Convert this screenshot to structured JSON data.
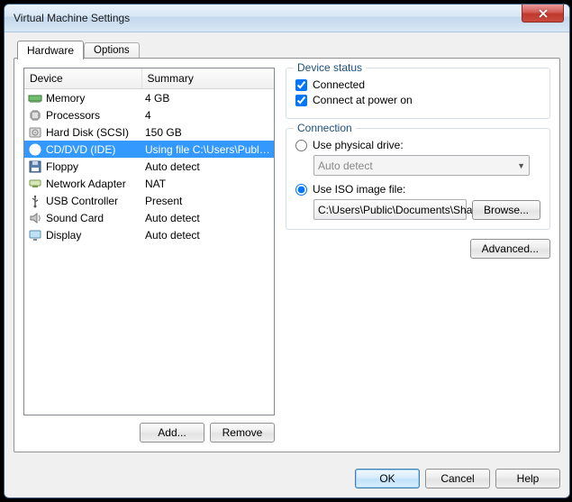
{
  "window": {
    "title": "Virtual Machine Settings"
  },
  "tabs": {
    "hardware": "Hardware",
    "options": "Options"
  },
  "headers": {
    "device": "Device",
    "summary": "Summary"
  },
  "devices": [
    {
      "icon": "memory",
      "name": "Memory",
      "summary": "4 GB"
    },
    {
      "icon": "cpu",
      "name": "Processors",
      "summary": "4"
    },
    {
      "icon": "hdd",
      "name": "Hard Disk (SCSI)",
      "summary": "150 GB"
    },
    {
      "icon": "cd",
      "name": "CD/DVD (IDE)",
      "summary": "Using file C:\\Users\\Public\\Doc..."
    },
    {
      "icon": "floppy",
      "name": "Floppy",
      "summary": "Auto detect"
    },
    {
      "icon": "net",
      "name": "Network Adapter",
      "summary": "NAT"
    },
    {
      "icon": "usb",
      "name": "USB Controller",
      "summary": "Present"
    },
    {
      "icon": "sound",
      "name": "Sound Card",
      "summary": "Auto detect"
    },
    {
      "icon": "display",
      "name": "Display",
      "summary": "Auto detect"
    }
  ],
  "left_buttons": {
    "add": "Add...",
    "remove": "Remove"
  },
  "groups": {
    "status": "Device status",
    "connection": "Connection"
  },
  "status": {
    "connected": "Connected",
    "connect_power_on": "Connect at power on"
  },
  "connection": {
    "use_physical": "Use physical drive:",
    "physical_value": "Auto detect",
    "use_iso": "Use ISO image file:",
    "iso_path": "C:\\Users\\Public\\Documents\\Sha",
    "browse": "Browse..."
  },
  "advanced": "Advanced...",
  "footer": {
    "ok": "OK",
    "cancel": "Cancel",
    "help": "Help"
  }
}
